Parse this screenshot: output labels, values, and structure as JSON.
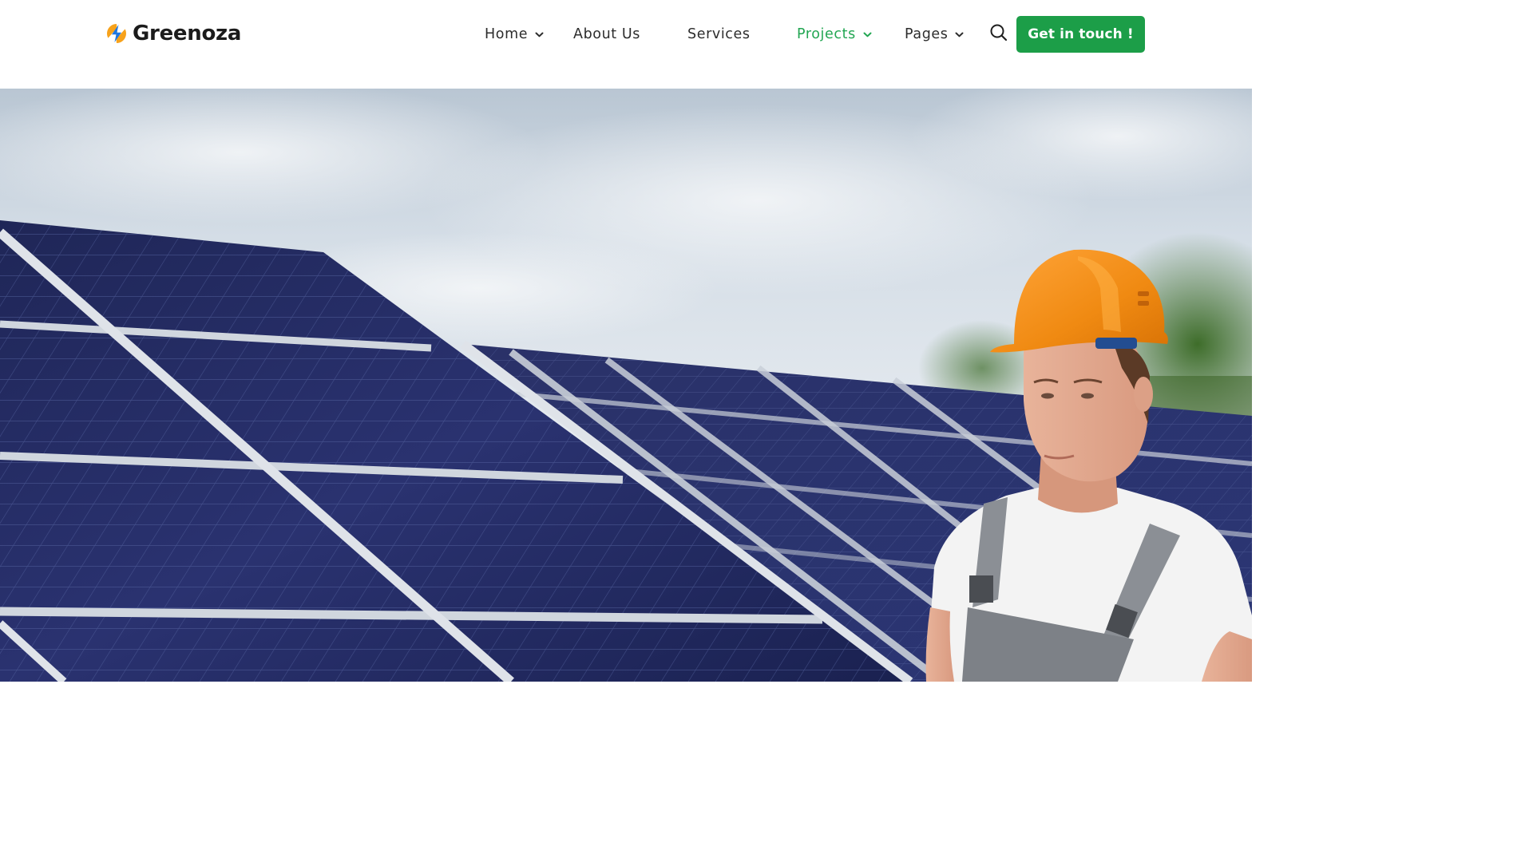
{
  "brand": {
    "name": "Greenoza",
    "logo_colors": {
      "orange": "#f7a21b",
      "blue": "#1e77e3"
    }
  },
  "nav": {
    "items": [
      {
        "label": "Home",
        "has_dropdown": true,
        "active": false
      },
      {
        "label": "About Us",
        "has_dropdown": false,
        "active": false
      },
      {
        "label": "Services",
        "has_dropdown": false,
        "active": false
      },
      {
        "label": "Projects",
        "has_dropdown": true,
        "active": true
      },
      {
        "label": "Pages",
        "has_dropdown": true,
        "active": false
      }
    ],
    "search_icon": "search-icon",
    "dropdown_icon": "chevron-down-icon"
  },
  "cta": {
    "label": "Get in touch !"
  },
  "colors": {
    "accent": "#1c9e48",
    "active_nav": "#22a652",
    "text": "#2c2c2c"
  },
  "hero": {
    "image": "solar-panels-worker-photo"
  }
}
